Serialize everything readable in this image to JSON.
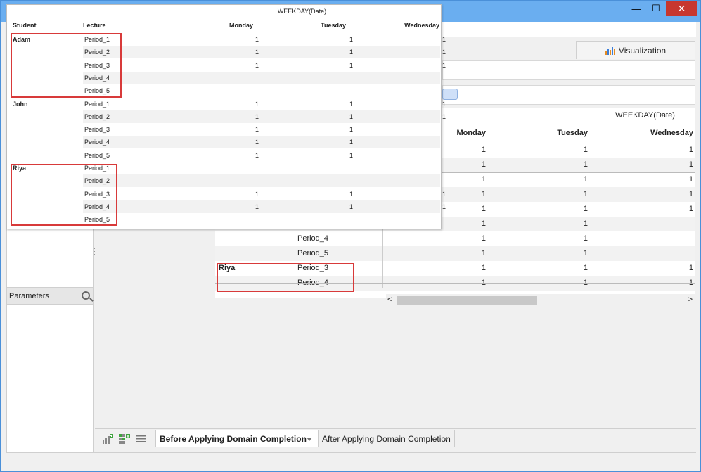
{
  "window": {
    "minimize_glyph": "—",
    "maximize_glyph": "☐",
    "close_glyph": "✕",
    "accent": "#6aaef0",
    "close_color": "#c7372f"
  },
  "visualization_tab": {
    "label": "Visualization",
    "icon": "chart-icon"
  },
  "parameters": {
    "title": "Parameters",
    "icon": "search-icon"
  },
  "bottom_tabs": [
    {
      "label": "Before Applying Domain Completion",
      "active": true
    },
    {
      "label": "After Applying Domain Completion",
      "active": false
    }
  ],
  "background_grid": {
    "title": "WEEKDAY(Date)",
    "columns": [
      "Monday",
      "Tuesday",
      "Wednesday"
    ],
    "rows": [
      {
        "student": "",
        "lecture": "",
        "values": [
          "1",
          "1",
          "1"
        ]
      },
      {
        "student": "",
        "lecture": "",
        "values": [
          "1",
          "1",
          "1"
        ]
      },
      {
        "student": "",
        "lecture": "",
        "values": [
          "1",
          "1",
          "1"
        ]
      },
      {
        "student": "",
        "lecture": "",
        "values": [
          "1",
          "1",
          "1"
        ]
      },
      {
        "student": "",
        "lecture": "",
        "values": [
          "1",
          "1",
          "1"
        ]
      },
      {
        "student": "",
        "lecture": "",
        "values": [
          "1",
          "1",
          ""
        ]
      },
      {
        "student": "",
        "lecture": "Period_4",
        "values": [
          "1",
          "1",
          ""
        ]
      },
      {
        "student": "",
        "lecture": "Period_5",
        "values": [
          "1",
          "1",
          ""
        ]
      },
      {
        "student": "Riya",
        "lecture": "Period_3",
        "values": [
          "1",
          "1",
          "1"
        ]
      },
      {
        "student": "",
        "lecture": "Period_4",
        "values": [
          "1",
          "1",
          "1"
        ]
      }
    ]
  },
  "popup_grid": {
    "title": "WEEKDAY(Date)",
    "headers": {
      "student": "Student",
      "lecture": "Lecture"
    },
    "columns": [
      "Monday",
      "Tuesday",
      "Wednesday"
    ],
    "groups": [
      {
        "student": "Adam",
        "rows": [
          {
            "lecture": "Period_1",
            "values": [
              "1",
              "1",
              "1"
            ]
          },
          {
            "lecture": "Period_2",
            "values": [
              "1",
              "1",
              "1"
            ]
          },
          {
            "lecture": "Period_3",
            "values": [
              "1",
              "1",
              "1"
            ]
          },
          {
            "lecture": "Period_4",
            "values": [
              "",
              "",
              ""
            ]
          },
          {
            "lecture": "Period_5",
            "values": [
              "",
              "",
              ""
            ]
          }
        ]
      },
      {
        "student": "John",
        "rows": [
          {
            "lecture": "Period_1",
            "values": [
              "1",
              "1",
              "1"
            ]
          },
          {
            "lecture": "Period_2",
            "values": [
              "1",
              "1",
              "1"
            ]
          },
          {
            "lecture": "Period_3",
            "values": [
              "1",
              "1",
              ""
            ]
          },
          {
            "lecture": "Period_4",
            "values": [
              "1",
              "1",
              ""
            ]
          },
          {
            "lecture": "Period_5",
            "values": [
              "1",
              "1",
              ""
            ]
          }
        ]
      },
      {
        "student": "Riya",
        "rows": [
          {
            "lecture": "Period_1",
            "values": [
              "",
              "",
              ""
            ]
          },
          {
            "lecture": "Period_2",
            "values": [
              "",
              "",
              ""
            ]
          },
          {
            "lecture": "Period_3",
            "values": [
              "1",
              "1",
              "1"
            ]
          },
          {
            "lecture": "Period_4",
            "values": [
              "1",
              "1",
              "1"
            ]
          },
          {
            "lecture": "Period_5",
            "values": [
              "",
              "",
              ""
            ]
          }
        ]
      }
    ]
  },
  "highlight_color": "#d83a3a"
}
